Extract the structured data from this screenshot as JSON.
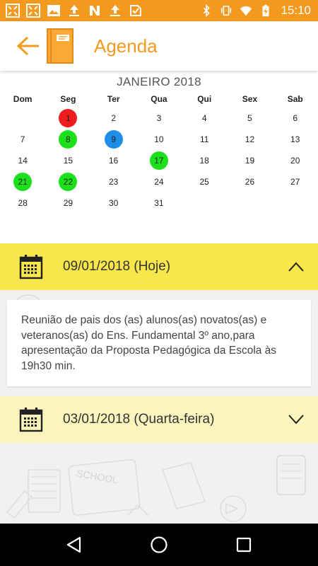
{
  "status_bar": {
    "time": "15:10",
    "left_icons": [
      "fullscreen-icon",
      "fullscreen-icon",
      "image-icon",
      "upload-icon",
      "n-icon",
      "upload-icon",
      "check-icon"
    ],
    "right_icons": [
      "bluetooth-icon",
      "vibrate-icon",
      "wifi-icon",
      "battery-charging-icon"
    ]
  },
  "header": {
    "title": "Agenda",
    "back_icon": "arrow-left-icon",
    "logo_icon": "notebook-icon"
  },
  "calendar": {
    "month": "JANEIRO 2018",
    "weekdays": [
      "Dom",
      "Seg",
      "Ter",
      "Qua",
      "Qui",
      "Sex",
      "Sab"
    ],
    "weeks": [
      [
        "",
        "1",
        "2",
        "3",
        "4",
        "5",
        "6"
      ],
      [
        "7",
        "8",
        "9",
        "10",
        "11",
        "12",
        "13"
      ],
      [
        "14",
        "15",
        "16",
        "17",
        "18",
        "19",
        "20"
      ],
      [
        "21",
        "22",
        "23",
        "24",
        "25",
        "26",
        "27"
      ],
      [
        "28",
        "29",
        "30",
        "31",
        "",
        "",
        ""
      ]
    ],
    "highlights": [
      {
        "day": "1",
        "color": "#ee1c1c"
      },
      {
        "day": "8",
        "color": "#1be01b"
      },
      {
        "day": "9",
        "color": "#1d8fe8"
      },
      {
        "day": "17",
        "color": "#1be01b"
      },
      {
        "day": "21",
        "color": "#1be01b"
      },
      {
        "day": "22",
        "color": "#1be01b"
      }
    ]
  },
  "events": [
    {
      "date_label": "09/01/2018 (Hoje)",
      "expanded": true,
      "description": "Reunião de pais dos (as) alunos(as) novatos(as) e veteranos(as) do Ens. Fundamental 3º ano,para apresentação da Proposta Pedagógica da Escola às 19h30 min."
    },
    {
      "date_label": "03/01/2018 (Quarta-feira)",
      "expanded": false
    }
  ],
  "colors": {
    "accent": "#f39a1e",
    "expanded_header": "#f7e74a",
    "collapsed_header": "#fbf5bd"
  },
  "nav_bar": [
    "back-triangle-icon",
    "home-circle-icon",
    "recents-square-icon"
  ]
}
